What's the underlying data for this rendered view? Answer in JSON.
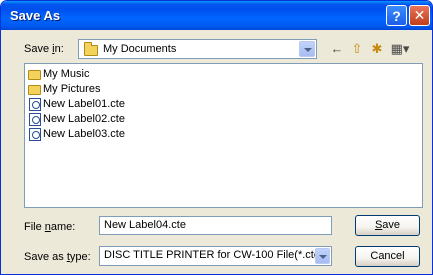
{
  "window": {
    "title": "Save As",
    "help_label": "?",
    "close_label": "✕"
  },
  "lookin": {
    "label_prefix": "Save ",
    "label_underlined": "i",
    "label_suffix": "n:",
    "value": "My Documents"
  },
  "toolbar": {
    "back_icon": "←",
    "up_icon": "⇧",
    "new_folder_icon": "✱",
    "view_icon": "▦▾"
  },
  "files": [
    {
      "name": "My Music",
      "icon": "folder-music-icon"
    },
    {
      "name": "My Pictures",
      "icon": "folder-pictures-icon"
    },
    {
      "name": "New Label01.cte",
      "icon": "cte-file-icon"
    },
    {
      "name": "New Label02.cte",
      "icon": "cte-file-icon"
    },
    {
      "name": "New Label03.cte",
      "icon": "cte-file-icon"
    }
  ],
  "filename": {
    "label_prefix": "File ",
    "label_underlined": "n",
    "label_suffix": "ame:",
    "value": "New Label04.cte"
  },
  "filetype": {
    "label_prefix": "Save as ",
    "label_underlined": "t",
    "label_suffix": "ype:",
    "value": "DISC TITLE PRINTER for CW-100 File(*.cte"
  },
  "buttons": {
    "save_underlined": "S",
    "save_rest": "ave",
    "cancel": "Cancel"
  }
}
